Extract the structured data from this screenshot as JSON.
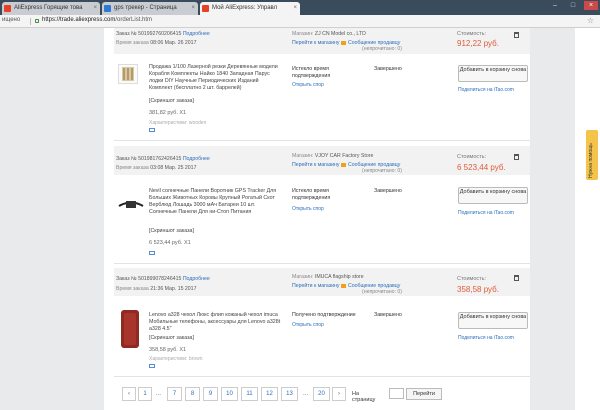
{
  "browser": {
    "tabs": [
      {
        "label": "AliExpress Горящие това",
        "active": false
      },
      {
        "label": "gps трекер - Страница",
        "active": false
      },
      {
        "label": "Мой AliExpress: Управл",
        "active": true
      }
    ],
    "nav_label": "ищено",
    "url_domain": "https://trade.aliexpress.com",
    "url_path": "/orderList.htm"
  },
  "labels": {
    "order_prefix": "Заказ №",
    "details": "Подробнее",
    "time_prefix": "Время заказа",
    "shop_prefix": "Магазин:",
    "go_to_store": "Перейти к магазину",
    "message": "Сообщение продавцу",
    "unread": "(непрочитано: 0)",
    "cost_label": "Стоимость:",
    "screenshot": "[Скриншот заказа]",
    "confirm_expired": "Истекло время подтверждения",
    "dispute": "Открыть спор",
    "completed": "Завершено",
    "add_to_cart": "Добавить в корзину снова",
    "share": "Поделиться на iTao.com",
    "quantity_suffix": "X1"
  },
  "orders": [
    {
      "id": "501992760206415",
      "time": "08:06 Мар. 26 2017",
      "shop": "ZJ CN Model co., LTD",
      "cost": "912,22 руб.",
      "product_title": "Продажа 1/100 Лазерной резки Деревянные модели Корабля Комплекты Найко 1840 Западная Парус лодки DIY Научные Периодических Изданий Комплект (бесплатно 2 шт. баррелей)",
      "price": "381,82 руб.",
      "chars": "Характеристики: wooden",
      "status": "Истекло время подтверждения",
      "result": "Завершено"
    },
    {
      "id": "501981762426415",
      "time": "03:08 Мар. 25 2017",
      "shop": "VJOY CAR Factory Store",
      "cost": "6 523,44 руб.",
      "product_title": "Nevil солнечные Панели Воротник GPS Tracker Для Больших Животных Коровы Крупный Рогатый Скот Верблюд Лошадь 3000 мАч Батареи 10 шт. Солнечные Панели Для ни-Стоп Питания",
      "price": "6 523,44 руб.",
      "chars": "",
      "status": "Истекло время подтверждения",
      "result": "Завершено"
    },
    {
      "id": "501899078246415",
      "time": "21:36 Мар. 15 2017",
      "shop": "IMUCA flagship store",
      "cost": "358,58 руб.",
      "product_title": "Lenovo a328 чехол Люкс флип кожаный чехол imuca Мобильные телефоны, аксессуары для Lenovo a328t a328 4.5\"",
      "price": "358,58 руб.",
      "chars": "Характеристики: brown",
      "status": "Получено подтверждение",
      "result": "Завершено"
    }
  ],
  "pagination": {
    "prev": "‹",
    "pages": [
      "1",
      "7",
      "8",
      "9",
      "10",
      "11",
      "12",
      "13",
      "20"
    ],
    "dots": "...",
    "next": "›",
    "goto_label": "На страницу",
    "goto_button": "Перейти"
  },
  "side_feedback": "Нужна помощь"
}
